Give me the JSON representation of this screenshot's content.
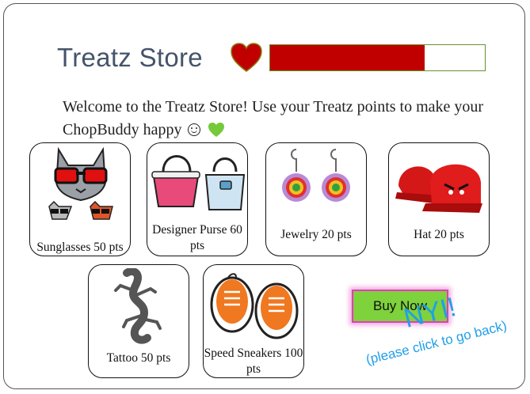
{
  "store": {
    "title": "Treatz Store",
    "health_fraction": 0.72,
    "welcome_text": "Welcome to the Treatz Store! Use your Treatz points to make your ChopBuddy happy"
  },
  "items": [
    {
      "label": "Sunglasses 50 pts",
      "icon": "cat-sunglasses-icon"
    },
    {
      "label": "Designer Purse 60 pts",
      "icon": "purse-icon"
    },
    {
      "label": "Jewelry 20 pts",
      "icon": "earrings-icon"
    },
    {
      "label": "Hat 20 pts",
      "icon": "cap-icon"
    },
    {
      "label": "Tattoo 50 pts",
      "icon": "gecko-icon"
    },
    {
      "label": "Speed Sneakers 100 pts",
      "icon": "sneakers-icon"
    }
  ],
  "actions": {
    "buy_label": "Buy Now",
    "nyi_label": "NYI!",
    "go_back_label": "(please click to go back)"
  },
  "colors": {
    "health_fill": "#c00000",
    "buy_bg": "#7ed23c",
    "buy_glow": "#e43cb8",
    "note_blue": "#1f9fe8",
    "title": "#44546a"
  }
}
